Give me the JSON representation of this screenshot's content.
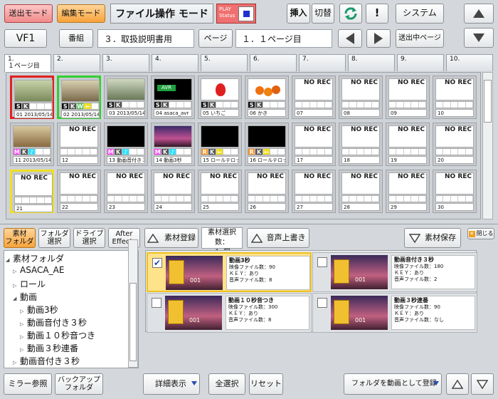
{
  "header": {
    "send_mode": "送出モード",
    "edit_mode": "編集モード",
    "title": "ファイル操作 モード",
    "play_status_line1": "PLAY",
    "play_status_line2": "Status",
    "insert": "挿入",
    "switch": "切替",
    "exclaim": "!",
    "system": "システム"
  },
  "row2": {
    "vf": "VF1",
    "program_label": "番組",
    "program_value": "３．取扱説明書用",
    "page_label": "ページ",
    "page_value": "１．１ページ目",
    "sending_page": "送出中ページ"
  },
  "tabs": [
    {
      "num": "1.",
      "name": "１ページ目"
    },
    {
      "num": "2.",
      "name": ""
    },
    {
      "num": "3.",
      "name": ""
    },
    {
      "num": "4.",
      "name": ""
    },
    {
      "num": "5.",
      "name": ""
    },
    {
      "num": "6.",
      "name": ""
    },
    {
      "num": "7.",
      "name": ""
    },
    {
      "num": "8.",
      "name": ""
    },
    {
      "num": "9.",
      "name": ""
    },
    {
      "num": "10.",
      "name": ""
    }
  ],
  "cells": [
    {
      "label": "01  2013/05/14",
      "badges": [
        "S",
        "K"
      ],
      "norec": ""
    },
    {
      "label": "02  2013/05/14",
      "badges": [
        "S",
        "K",
        "W",
        "←"
      ],
      "norec": ""
    },
    {
      "label": "03  2013/05/14",
      "badges": [
        "S",
        "K"
      ],
      "norec": ""
    },
    {
      "label": "04  asaca_avr",
      "badges": [
        "S",
        "K"
      ],
      "norec": ""
    },
    {
      "label": "05  いちご",
      "badges": [
        "S",
        "K"
      ],
      "norec": ""
    },
    {
      "label": "06  かき",
      "badges": [
        "S",
        "K"
      ],
      "norec": ""
    },
    {
      "label": "07",
      "badges": [],
      "norec": "NO REC"
    },
    {
      "label": "08",
      "badges": [],
      "norec": "NO REC"
    },
    {
      "label": "09",
      "badges": [],
      "norec": "NO REC"
    },
    {
      "label": "10",
      "badges": [],
      "norec": "NO REC"
    },
    {
      "label": "11  2013/05/14",
      "badges": [
        "M",
        "K",
        "♪"
      ],
      "norec": ""
    },
    {
      "label": "12",
      "badges": [],
      "norec": "NO REC"
    },
    {
      "label": "13  動画音付き３",
      "badges": [
        "M",
        "K",
        "♪"
      ],
      "norec": ""
    },
    {
      "label": "14  動画3秒",
      "badges": [
        "M",
        "K",
        "♪"
      ],
      "norec": ""
    },
    {
      "label": "15  ロールテロップ",
      "badges": [
        "R",
        "K",
        "←"
      ],
      "norec": ""
    },
    {
      "label": "16  ロールテロップ",
      "badges": [
        "R",
        "K",
        "←"
      ],
      "norec": ""
    },
    {
      "label": "17",
      "badges": [],
      "norec": "NO REC"
    },
    {
      "label": "18",
      "badges": [],
      "norec": "NO REC"
    },
    {
      "label": "19",
      "badges": [],
      "norec": "NO REC"
    },
    {
      "label": "20",
      "badges": [],
      "norec": "NO REC"
    },
    {
      "label": "21",
      "badges": [],
      "norec": "NO REC"
    },
    {
      "label": "22",
      "badges": [],
      "norec": "NO REC"
    },
    {
      "label": "23",
      "badges": [],
      "norec": "NO REC"
    },
    {
      "label": "24",
      "badges": [],
      "norec": "NO REC"
    },
    {
      "label": "25",
      "badges": [],
      "norec": "NO REC"
    },
    {
      "label": "26",
      "badges": [],
      "norec": "NO REC"
    },
    {
      "label": "27",
      "badges": [],
      "norec": "NO REC"
    },
    {
      "label": "28",
      "badges": [],
      "norec": "NO REC"
    },
    {
      "label": "29",
      "badges": [],
      "norec": "NO REC"
    },
    {
      "label": "30",
      "badges": [],
      "norec": "NO REC"
    }
  ],
  "thumb_text": {
    "avr": "AVR"
  },
  "material_bar": {
    "material_folder_l1": "素材",
    "material_folder_l2": "フォルダ",
    "folder_select_l1": "フォルダ",
    "folder_select_l2": "選択",
    "drive_select_l1": "ドライブ",
    "drive_select_l2": "選択",
    "after_effects_l1": "After",
    "after_effects_l2": "Effects",
    "register": "素材登録",
    "count_label": "素材選択数：",
    "count_value": "１ 個",
    "voice_overwrite": "音声上書き",
    "save": "素材保存",
    "close": "閉じる"
  },
  "tree": [
    {
      "label": "素材フォルダ",
      "level": 0,
      "arrow": "◢"
    },
    {
      "label": "ASACA_AE",
      "level": 1,
      "arrow": "▷"
    },
    {
      "label": "ロール",
      "level": 1,
      "arrow": "▷"
    },
    {
      "label": "動画",
      "level": 1,
      "arrow": "◢"
    },
    {
      "label": "動画3秒",
      "level": 2,
      "arrow": "▷"
    },
    {
      "label": "動画音付き３秒",
      "level": 2,
      "arrow": "▷"
    },
    {
      "label": "動画１０秒音つき",
      "level": 2,
      "arrow": "▷"
    },
    {
      "label": "動画３秒連番",
      "level": 2,
      "arrow": "▷"
    },
    {
      "label": "動画音付き３秒",
      "level": 1,
      "arrow": "▷"
    }
  ],
  "materials": [
    {
      "title": "動画3秒",
      "l1": "映像ファイル数：90",
      "l2": "ＫＥＹ：あり",
      "l3": "音声ファイル数：8",
      "checked": true,
      "num": "001"
    },
    {
      "title": "動画音付き３秒",
      "l1": "映像ファイル数：180",
      "l2": "ＫＥＹ：あり",
      "l3": "音声ファイル数：2",
      "checked": false,
      "num": "001"
    },
    {
      "title": "動画１０秒音つき",
      "l1": "映像ファイル数：300",
      "l2": "ＫＥＹ：あり",
      "l3": "音声ファイル数：8",
      "checked": false,
      "num": "001"
    },
    {
      "title": "動画３秒連番",
      "l1": "映像ファイル数：90",
      "l2": "ＫＥＹ：あり",
      "l3": "音声ファイル数：なし",
      "checked": false,
      "num": "001"
    }
  ],
  "checkmark": "✔",
  "footer": {
    "mirror": "ミラー参照",
    "backup_l1": "バックアップ",
    "backup_l2": "フォルダ",
    "detail": "詳細表示",
    "select_all": "全選択",
    "reset": "リセット",
    "register_as_video": "フォルダを動画として登録"
  },
  "colors": {
    "badge_S": "#111111",
    "badge_M": "#ff40ff",
    "badge_R": "#ff9020",
    "badge_K": "#555555",
    "badge_W": "#40c040",
    "badge_note": "#30e0ff",
    "badge_arrow": "#f0e020"
  }
}
